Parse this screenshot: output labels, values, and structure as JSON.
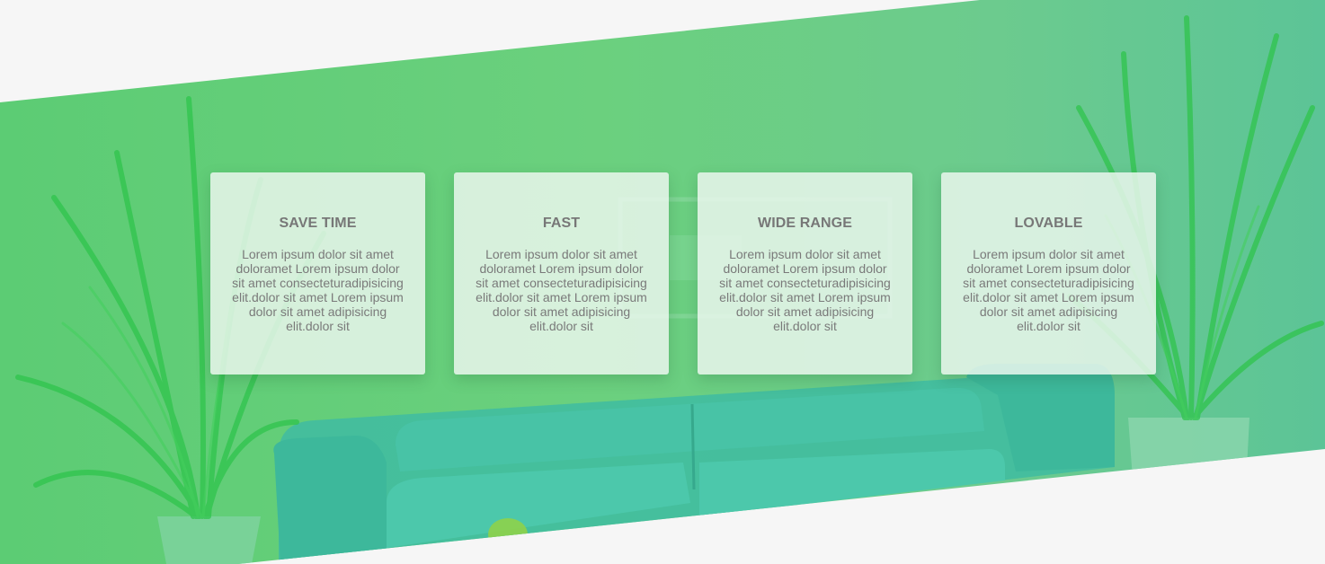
{
  "colors": {
    "page_background": "#f6f6f6",
    "band_green": "#6bd07e",
    "band_teal": "#5cc497",
    "sofa": "#3fbfa0",
    "plant": "#2ec24a",
    "card_background": "#ecf7ee",
    "card_title": "#777777",
    "card_text": "#7a7a7a"
  },
  "hero": {
    "background_image": "living room with teal sofa and potted plants, green overlay"
  },
  "features": [
    {
      "title": "SAVE TIME",
      "text": "Lorem ipsum dolor sit amet doloramet Lorem ipsum dolor sit amet consecteturadipisicing elit.dolor sit amet Lorem ipsum dolor sit amet adipisicing elit.dolor sit"
    },
    {
      "title": "FAST",
      "text": "Lorem ipsum dolor sit amet doloramet Lorem ipsum dolor sit amet consecteturadipisicing elit.dolor sit amet Lorem ipsum dolor sit amet adipisicing elit.dolor sit"
    },
    {
      "title": "WIDE RANGE",
      "text": "Lorem ipsum dolor sit amet doloramet Lorem ipsum dolor sit amet consecteturadipisicing elit.dolor sit amet Lorem ipsum dolor sit amet adipisicing elit.dolor sit"
    },
    {
      "title": "LOVABLE",
      "text": "Lorem ipsum dolor sit amet doloramet Lorem ipsum dolor sit amet consecteturadipisicing elit.dolor sit amet Lorem ipsum dolor sit amet adipisicing elit.dolor sit"
    }
  ]
}
